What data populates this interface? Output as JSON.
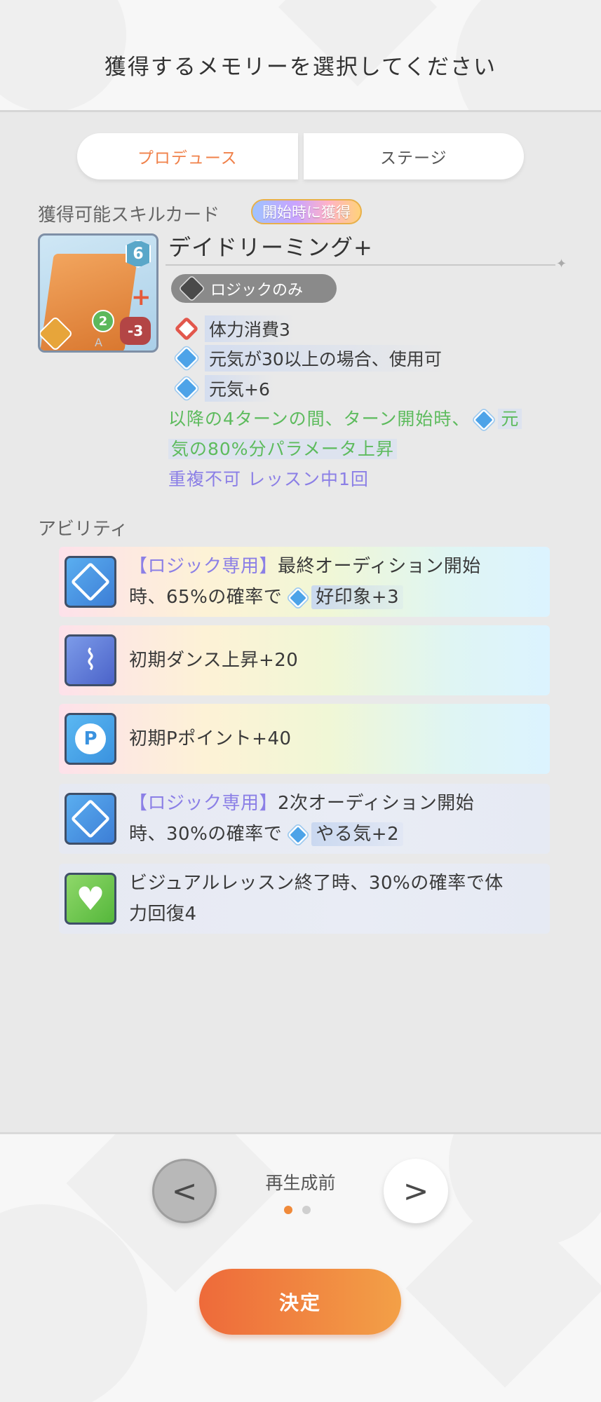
{
  "header": {
    "title": "獲得するメモリーを選択してください"
  },
  "tabs": [
    {
      "label": "プロデュース",
      "active": true
    },
    {
      "label": "ステージ",
      "active": false
    }
  ],
  "skill_section": {
    "label": "獲得可能スキルカード",
    "badge": "開始時に獲得",
    "card": {
      "name": "デイドリーミング+",
      "cost_badge": "6",
      "level_badge": "2",
      "hp_badge": "-3",
      "rank": "A",
      "type_pill": "ロジックのみ",
      "effects": [
        {
          "icon": "stamina-cost-icon",
          "text": "体力消費3"
        },
        {
          "icon": "genki-icon",
          "text": "元気が30以上の場合、使用可"
        },
        {
          "icon": "genki-icon",
          "text": "元気+6"
        }
      ],
      "green_line1a": "以降の4ターンの間、ターン開始時、",
      "green_line1b": "元",
      "green_line2": "気の80%分パラメータ上昇",
      "purple_line": "重複不可 レッスン中1回"
    }
  },
  "ability_section": {
    "label": "アビリティ",
    "items": [
      {
        "icon": "logic-diamond-icon",
        "tag": "【ロジック専用】",
        "line1": "最終オーディション開始",
        "line2": "時、65%の確率で",
        "pill": "好印象+3"
      },
      {
        "icon": "dance-shoe-icon",
        "text": "初期ダンス上昇+20"
      },
      {
        "icon": "p-point-icon",
        "icon_text": "P",
        "text": "初期Pポイント+40"
      },
      {
        "icon": "logic-diamond-icon",
        "tag": "【ロジック専用】",
        "line1": "2次オーディション開始",
        "line2": "時、30%の確率で",
        "pill": "やる気+2"
      },
      {
        "icon": "heart-icon",
        "line1": "ビジュアルレッスン終了時、30%の確率で体",
        "line2": "力回復4"
      }
    ]
  },
  "pager": {
    "label": "再生成前",
    "pages": 2,
    "current": 1,
    "prev": "<",
    "next": ">"
  },
  "confirm_button": "決定"
}
